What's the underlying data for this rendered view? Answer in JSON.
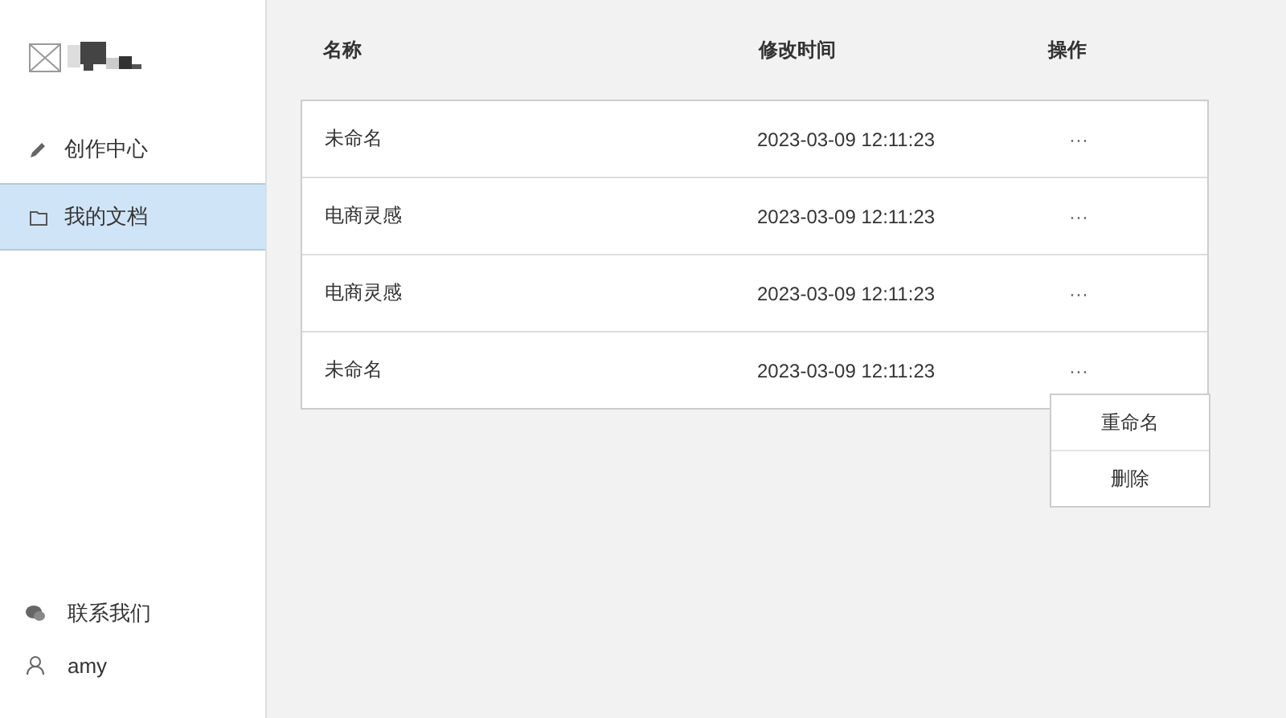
{
  "sidebar": {
    "items": [
      {
        "label": "创作中心",
        "kind": "pencil",
        "selected": false
      },
      {
        "label": "我的文档",
        "kind": "folder",
        "selected": true
      }
    ],
    "footer": [
      {
        "label": "联系我们",
        "kind": "chat"
      },
      {
        "label": "amy",
        "kind": "user"
      }
    ]
  },
  "table": {
    "columns": [
      "名称",
      "修改时间",
      "操作"
    ],
    "rows": [
      {
        "name": "未命名",
        "modified": "2023-03-09 12:11:23",
        "action": "···"
      },
      {
        "name": "电商灵感",
        "modified": "2023-03-09 12:11:23",
        "action": "···"
      },
      {
        "name": "电商灵感",
        "modified": "2023-03-09 12:11:23",
        "action": "···"
      },
      {
        "name": "未命名",
        "modified": "2023-03-09 12:11:23",
        "action": "···",
        "menu_open": true
      }
    ]
  },
  "menu": {
    "items": [
      "重命名",
      "删除"
    ]
  }
}
